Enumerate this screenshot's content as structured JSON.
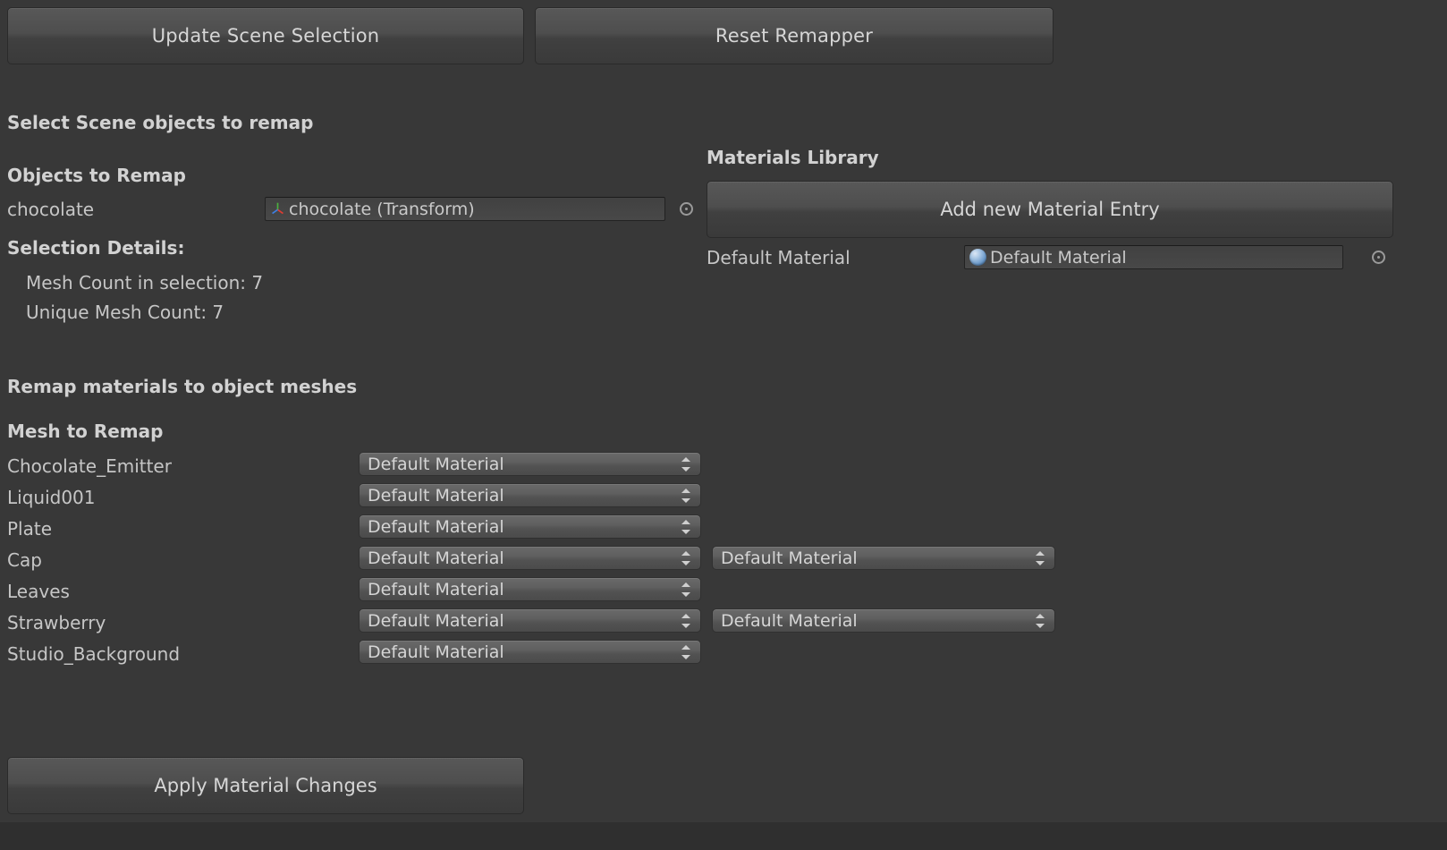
{
  "window": {
    "background_color": "#383838",
    "text_color": "#c6c6c6"
  },
  "toolbar": {
    "update_scene_selection_label": "Update Scene Selection",
    "reset_remapper_label": "Reset Remapper"
  },
  "scene_selection": {
    "section_title": "Select Scene objects to remap",
    "objects_to_remap_label": "Objects to Remap",
    "object_row": {
      "field_name": "chocolate",
      "value": "chocolate (Transform)",
      "icon": "transform-icon",
      "picker_icon": "object-picker-icon"
    },
    "selection_details_label": "Selection Details:",
    "mesh_count_line": "Mesh Count in selection: 7",
    "unique_mesh_count_line": "Unique Mesh Count: 7"
  },
  "materials_library": {
    "section_title": "Materials Library",
    "add_entry_label": "Add new Material Entry",
    "entry": {
      "field_name": "Default Material",
      "value": "Default Material",
      "icon": "material-sphere-icon",
      "picker_icon": "object-picker-icon"
    }
  },
  "remap": {
    "section_title": "Remap materials to object meshes",
    "column_header": "Mesh to Remap",
    "rows": [
      {
        "mesh": "Chocolate_Emitter",
        "material_1": "Default Material",
        "material_2": null
      },
      {
        "mesh": "Liquid001",
        "material_1": "Default Material",
        "material_2": null
      },
      {
        "mesh": "Plate",
        "material_1": "Default Material",
        "material_2": null
      },
      {
        "mesh": "Cap",
        "material_1": "Default Material",
        "material_2": "Default Material"
      },
      {
        "mesh": "Leaves",
        "material_1": "Default Material",
        "material_2": null
      },
      {
        "mesh": "Strawberry",
        "material_1": "Default Material",
        "material_2": "Default Material"
      },
      {
        "mesh": "Studio_Background",
        "material_1": "Default Material",
        "material_2": null
      }
    ]
  },
  "footer": {
    "apply_label": "Apply Material Changes"
  }
}
